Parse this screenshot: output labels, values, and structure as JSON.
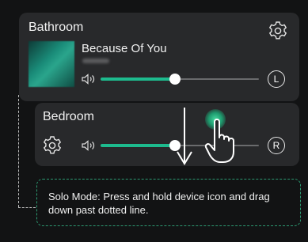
{
  "rooms": [
    {
      "name": "Bathroom",
      "track_title": "Because Of You",
      "volume": 0.47,
      "channel": "L"
    },
    {
      "name": "Bedroom",
      "volume": 0.47,
      "channel": "R"
    }
  ],
  "hint": {
    "text": "Solo Mode: Press and hold device icon and drag down past dotted line."
  },
  "colors": {
    "background": "#121314",
    "card": "#28292b",
    "accent": "#1dbb8e",
    "hint_border": "#2c9a72"
  },
  "icons": [
    "gear-icon",
    "volume-icon",
    "album-art",
    "down-arrow-icon",
    "hand-pointer-icon",
    "touch-indicator"
  ]
}
